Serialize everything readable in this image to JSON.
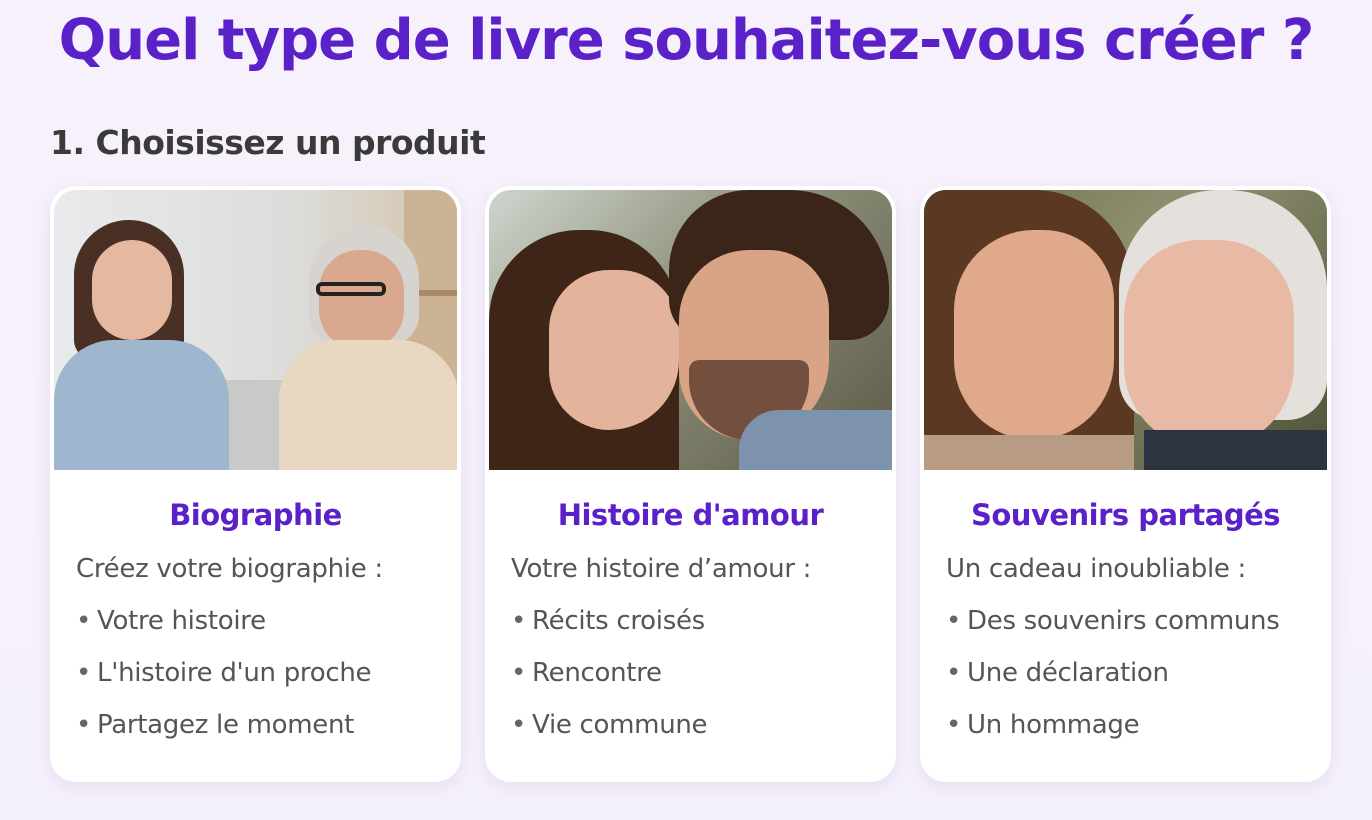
{
  "page": {
    "title": "Quel type de livre souhaitez-vous créer ?",
    "step_title": "1. Choisissez un produit"
  },
  "cards": [
    {
      "title": "Biographie",
      "intro": "Créez votre biographie :",
      "items": [
        "Votre histoire",
        "L'histoire d'un proche",
        "Partagez le moment"
      ]
    },
    {
      "title": "Histoire d'amour",
      "intro": "Votre histoire d’amour :",
      "items": [
        "Récits croisés",
        "Rencontre",
        "Vie commune"
      ]
    },
    {
      "title": "Souvenirs partagés",
      "intro": "Un cadeau inoubliable :",
      "items": [
        "Des souvenirs communs",
        "Une déclaration",
        "Un hommage"
      ]
    }
  ],
  "bullet": "•",
  "colors": {
    "accent": "#5b21c9",
    "background": "#f7f1fb",
    "card": "#ffffff",
    "text": "#555555"
  }
}
